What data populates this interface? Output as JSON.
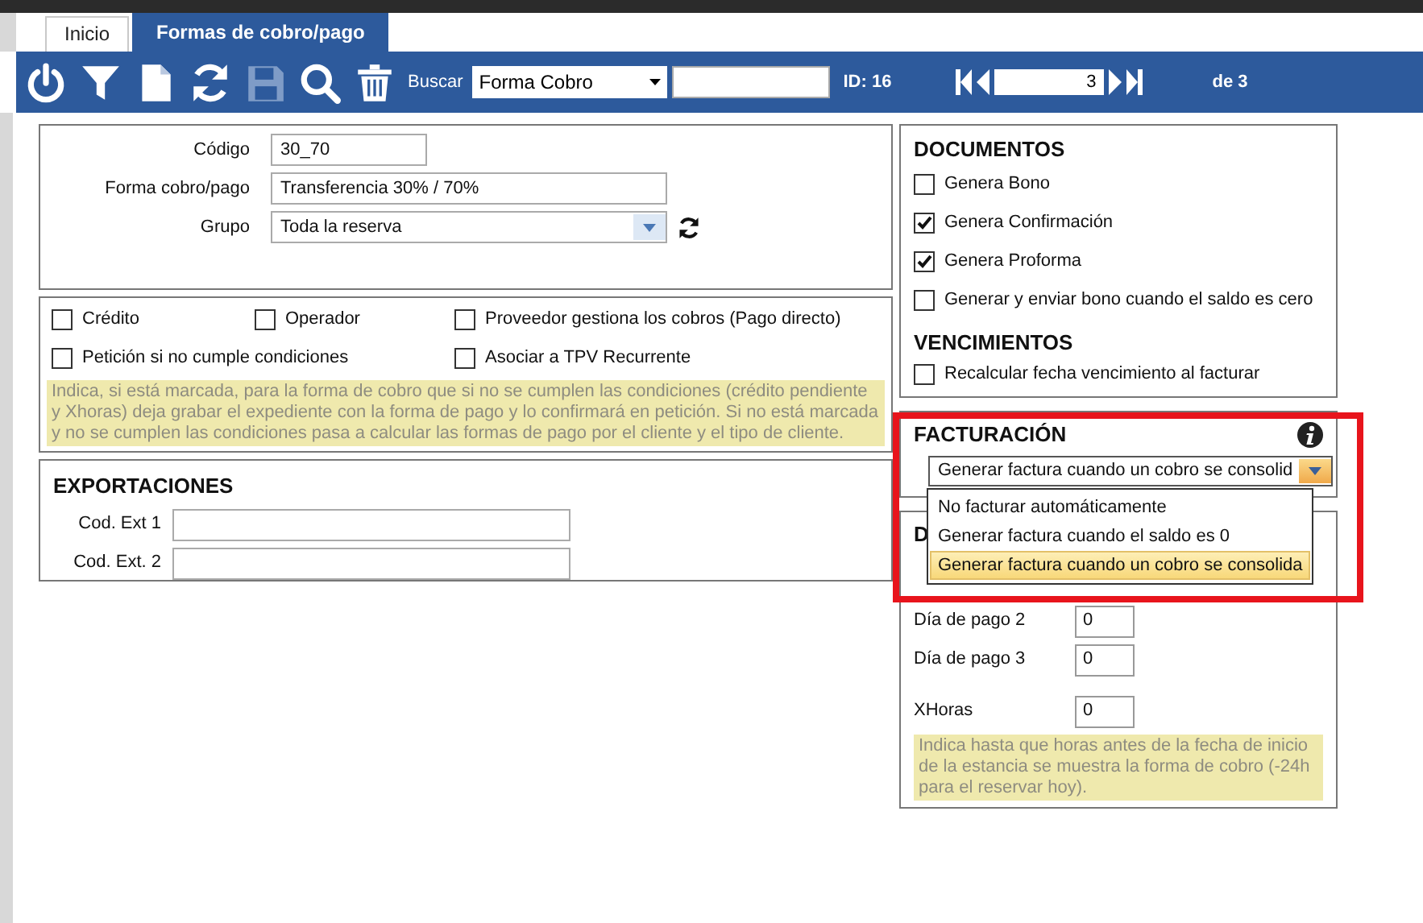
{
  "tabs": [
    {
      "label": "Inicio",
      "selected": false
    },
    {
      "label": "Formas de cobro/pago",
      "selected": true
    }
  ],
  "toolbar": {
    "buttons": [
      {
        "kind": "power",
        "disabled": false
      },
      {
        "kind": "filter",
        "disabled": false
      },
      {
        "kind": "new",
        "disabled": false
      },
      {
        "kind": "refresh",
        "disabled": false
      },
      {
        "kind": "save",
        "disabled": true
      },
      {
        "kind": "search",
        "disabled": false
      },
      {
        "kind": "delete",
        "disabled": false
      }
    ],
    "search_label": "Buscar",
    "search_field": "Forma Cobro",
    "id": "ID: 16",
    "record": "3",
    "total": "de 3"
  },
  "general": {
    "fields": [
      {
        "label": "Código",
        "value": "30_70",
        "kind": "text"
      },
      {
        "label": "Forma cobro/pago",
        "value": "Transferencia 30% / 70%",
        "kind": "text"
      },
      {
        "label": "Grupo",
        "value": "Toda la reserva",
        "kind": "select"
      }
    ]
  },
  "options": {
    "rows": [
      [
        {
          "label": "Crédito",
          "checked": false
        },
        {
          "label": "Operador",
          "checked": false
        },
        {
          "label": "Proveedor gestiona los cobros (Pago directo)",
          "checked": false
        }
      ],
      [
        {
          "label": "Petición si no cumple condiciones",
          "checked": false
        },
        null,
        {
          "label": "Asociar a TPV Recurrente",
          "checked": false
        }
      ]
    ],
    "note": "Indica, si está marcada, para la forma de cobro que si no se cumplen las condiciones (crédito pendiente y Xhoras) deja grabar el expediente con la forma de pago y lo confirmará en petición. Si no está marcada y no se cumplen las condiciones pasa a calcular las formas de pago por el cliente y el tipo de cliente."
  },
  "exportaciones": {
    "title": "EXPORTACIONES",
    "fields": [
      {
        "label": "Cod. Ext 1"
      },
      {
        "label": "Cod. Ext. 2"
      }
    ]
  },
  "documentos": {
    "title": "DOCUMENTOS",
    "checkboxes": [
      {
        "label": "Genera Bono",
        "checked": false
      },
      {
        "label": "Genera Confirmación",
        "checked": true
      },
      {
        "label": "Genera Proforma",
        "checked": true
      },
      {
        "label": "Generar y enviar bono cuando el saldo es cero",
        "checked": false
      }
    ]
  },
  "vencimientos": {
    "title": "VENCIMIENTOS",
    "checkboxes": [
      {
        "label": "Recalcular fecha vencimiento al facturar",
        "checked": false
      }
    ]
  },
  "facturacion": {
    "title": "FACTURACIÓN",
    "value": "Generar factura cuando un cobro se consolid",
    "options": [
      {
        "label": "No facturar automáticamente",
        "selected": false
      },
      {
        "label": "Generar factura cuando el saldo es 0",
        "selected": false
      },
      {
        "label": "Generar factura cuando un cobro se consolida",
        "selected": true
      }
    ]
  },
  "dias": {
    "title": "D",
    "fields": [
      {
        "label": "Día de pago 2",
        "value": "0"
      },
      {
        "label": "Día de pago 3",
        "value": "0"
      },
      {
        "label": "XHoras",
        "value": "0"
      }
    ],
    "note": "Indica hasta que horas antes de la fecha de inicio de la estancia se muestra la forma de cobro (-24h para el reservar hoy)."
  }
}
